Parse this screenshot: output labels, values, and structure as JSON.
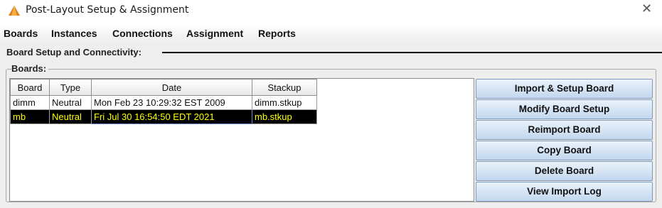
{
  "window": {
    "title": "Post-Layout Setup & Assignment"
  },
  "menubar": {
    "items": [
      "Boards",
      "Instances",
      "Connections",
      "Assignment",
      "Reports"
    ]
  },
  "section": {
    "title": "Board Setup and Connectivity:"
  },
  "boards_group": {
    "title": "Boards:"
  },
  "table": {
    "columns": [
      "Board",
      "Type",
      "Date",
      "Stackup"
    ],
    "rows": [
      [
        "dimm",
        "Neutral",
        "Mon Feb 23 10:29:32 EST 2009",
        "dimm.stkup"
      ],
      [
        "mb",
        "Neutral",
        "Fri Jul 30 16:54:50 EDT 2021",
        "mb.stkup"
      ]
    ]
  },
  "buttons": {
    "import_setup": "Import & Setup Board",
    "modify_setup": "Modify Board Setup",
    "reimport": "Reimport Board",
    "copy": "Copy Board",
    "delete": "Delete Board",
    "view_log": "View Import Log"
  }
}
